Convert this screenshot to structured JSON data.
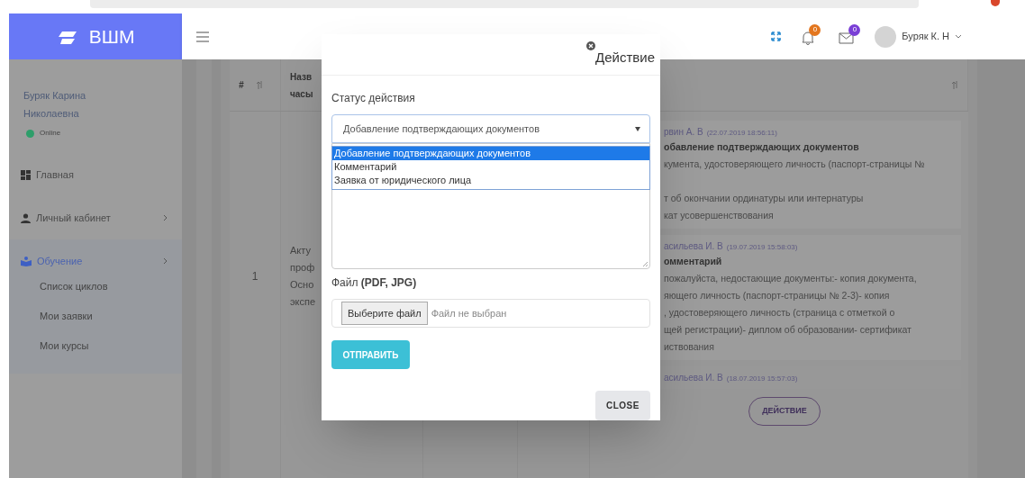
{
  "header": {
    "logo": "ВШМ",
    "notifications_count": "0",
    "messages_count": "0",
    "user_name": "Буряк К. Н"
  },
  "sidebar": {
    "user_name": "Буряк Карина Николаевна",
    "status": "Online",
    "items": [
      {
        "label": "Главная",
        "kind": "link",
        "selected": false
      },
      {
        "label": "Личный кабинет",
        "kind": "group",
        "selected": false
      },
      {
        "label": "Обучение",
        "kind": "group",
        "selected": true,
        "children": [
          {
            "label": "Список циклов"
          },
          {
            "label": "Мои заявки"
          },
          {
            "label": "Мои курсы"
          }
        ]
      }
    ]
  },
  "table": {
    "columns": [
      {
        "header_lines": [
          "#"
        ],
        "sortable": true
      },
      {
        "header_lines": [
          "Назв",
          "часы"
        ]
      },
      {
        "sortable": true
      }
    ],
    "rows": [
      {
        "number": "1",
        "name_lines": [
          "Акту",
          "проф",
          "Осно",
          "экспе"
        ],
        "history": [
          {
            "author": "рвин А. В",
            "time": "(22.07.2019 18:56:11)",
            "action": "обавление подтверждающих документов",
            "paragraphs": [
              [
                "кумента, удостоверяющего личность (паспорт-страницы №"
              ],
              [
                "т об окончании ординатуры или интернатуры",
                "кат усовершенствования"
              ]
            ]
          },
          {
            "author": "асильева И. В",
            "time": "(19.07.2019 15:58:03)",
            "action": "омментарий",
            "paragraphs": [
              [
                "пожалуйста, недостающие документы:- копия документа,",
                "яющего личность (паспорт-страницы № 2-3)- копия",
                ", удостоверяющего личность (страница с отметкой о",
                "щей регистрации)- диплом об образовании- сертификат",
                "иствования"
              ]
            ]
          },
          {
            "author": "асильева И. В",
            "time": "(18.07.2019 15:57:03)",
            "button": "ДЕЙСТВИЕ"
          }
        ]
      }
    ]
  },
  "modal": {
    "title": "Действие",
    "status_label": "Статус действия",
    "select_value": "Добавление подтверждающих документов",
    "options": [
      {
        "label": "Добавление подтверждающих документов",
        "selected": true
      },
      {
        "label": "Комментарий",
        "selected": false
      },
      {
        "label": "Заявка от юридического лица",
        "selected": false
      }
    ],
    "file_label": "Файл **(PDF, JPG)**",
    "file_button": "Выберите файл",
    "file_status": "Файл не выбран",
    "submit": "ОТПРАВИТЬ",
    "close": "CLOSE"
  }
}
